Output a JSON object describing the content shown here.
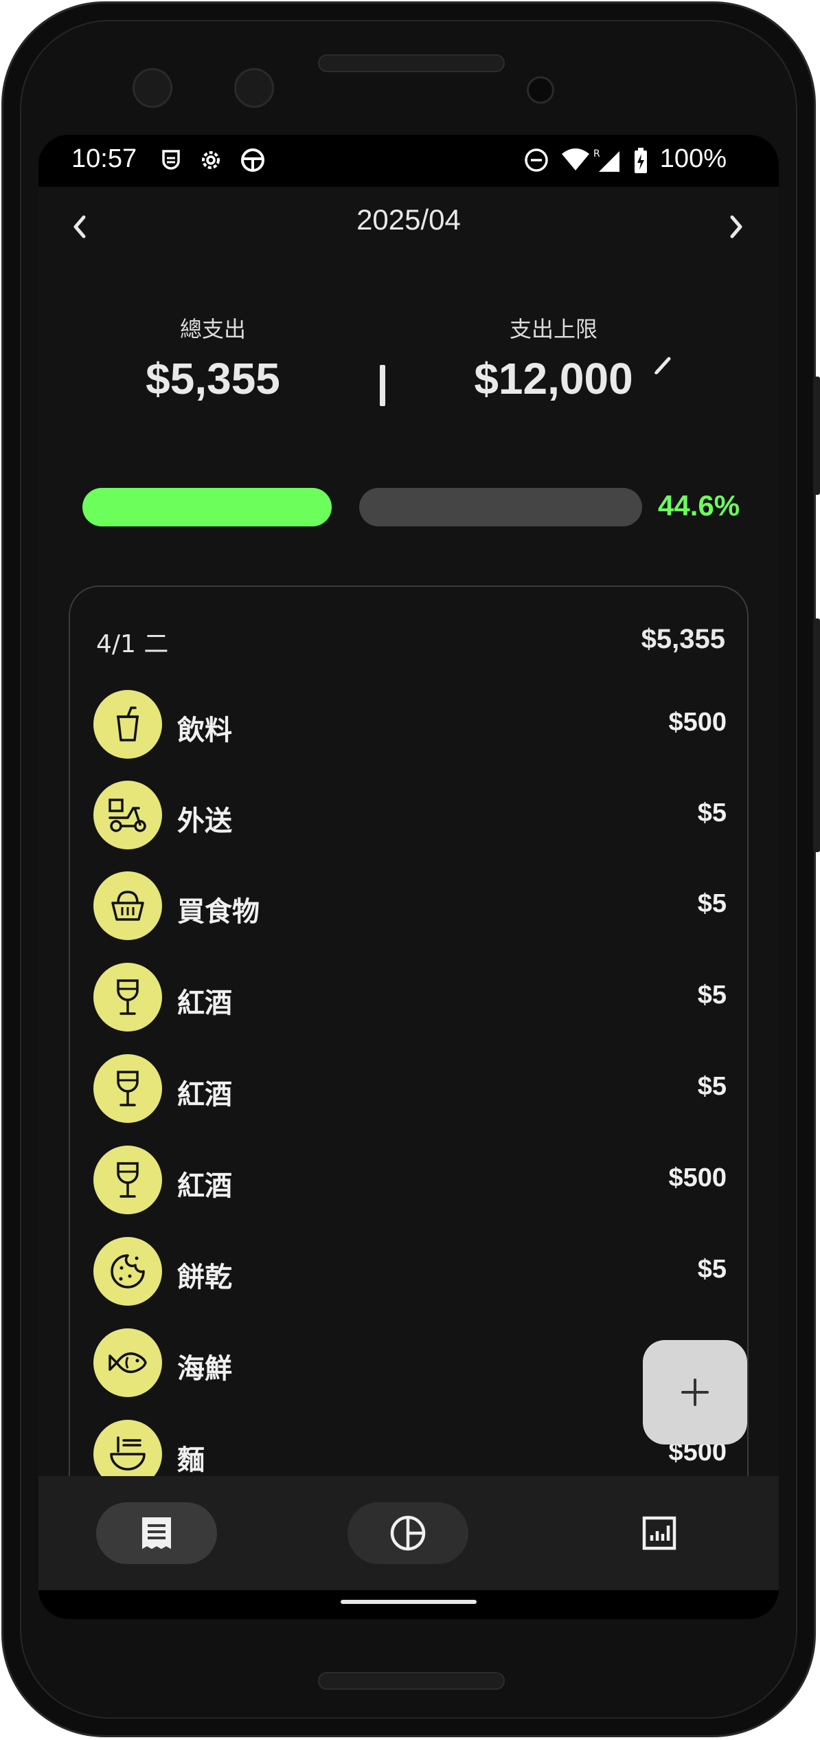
{
  "status_bar": {
    "time": "10:57",
    "battery": "100%"
  },
  "header": {
    "month": "2025/04"
  },
  "summary": {
    "total_label": "總支出",
    "total_value": "$5,355",
    "limit_label": "支出上限",
    "limit_value": "$12,000"
  },
  "progress": {
    "percent_text": "44.6%",
    "fraction": 0.446
  },
  "day_group": {
    "date_label": "4/1 二",
    "total": "$5,355",
    "items": [
      {
        "icon": "cup-icon",
        "name": "飲料",
        "amount": "$500"
      },
      {
        "icon": "scooter-delivery-icon",
        "name": "外送",
        "amount": "$5"
      },
      {
        "icon": "basket-icon",
        "name": "買食物",
        "amount": "$5"
      },
      {
        "icon": "wine-glass-icon",
        "name": "紅酒",
        "amount": "$5"
      },
      {
        "icon": "wine-glass-icon",
        "name": "紅酒",
        "amount": "$5"
      },
      {
        "icon": "wine-glass-icon",
        "name": "紅酒",
        "amount": "$500"
      },
      {
        "icon": "cookie-icon",
        "name": "餅乾",
        "amount": "$5"
      },
      {
        "icon": "fish-icon",
        "name": "海鮮",
        "amount": ""
      },
      {
        "icon": "noodle-bowl-icon",
        "name": "麵",
        "amount": "$500"
      }
    ]
  },
  "fab": {
    "icon": "plus-icon"
  },
  "bottom_nav": [
    {
      "icon": "receipt-icon",
      "active": true
    },
    {
      "icon": "pie-chart-icon",
      "active": false
    },
    {
      "icon": "bar-chart-icon",
      "active": false
    }
  ],
  "colors": {
    "accent": "#6cff5c",
    "category_circle": "#e6e67a",
    "background": "#131313"
  }
}
